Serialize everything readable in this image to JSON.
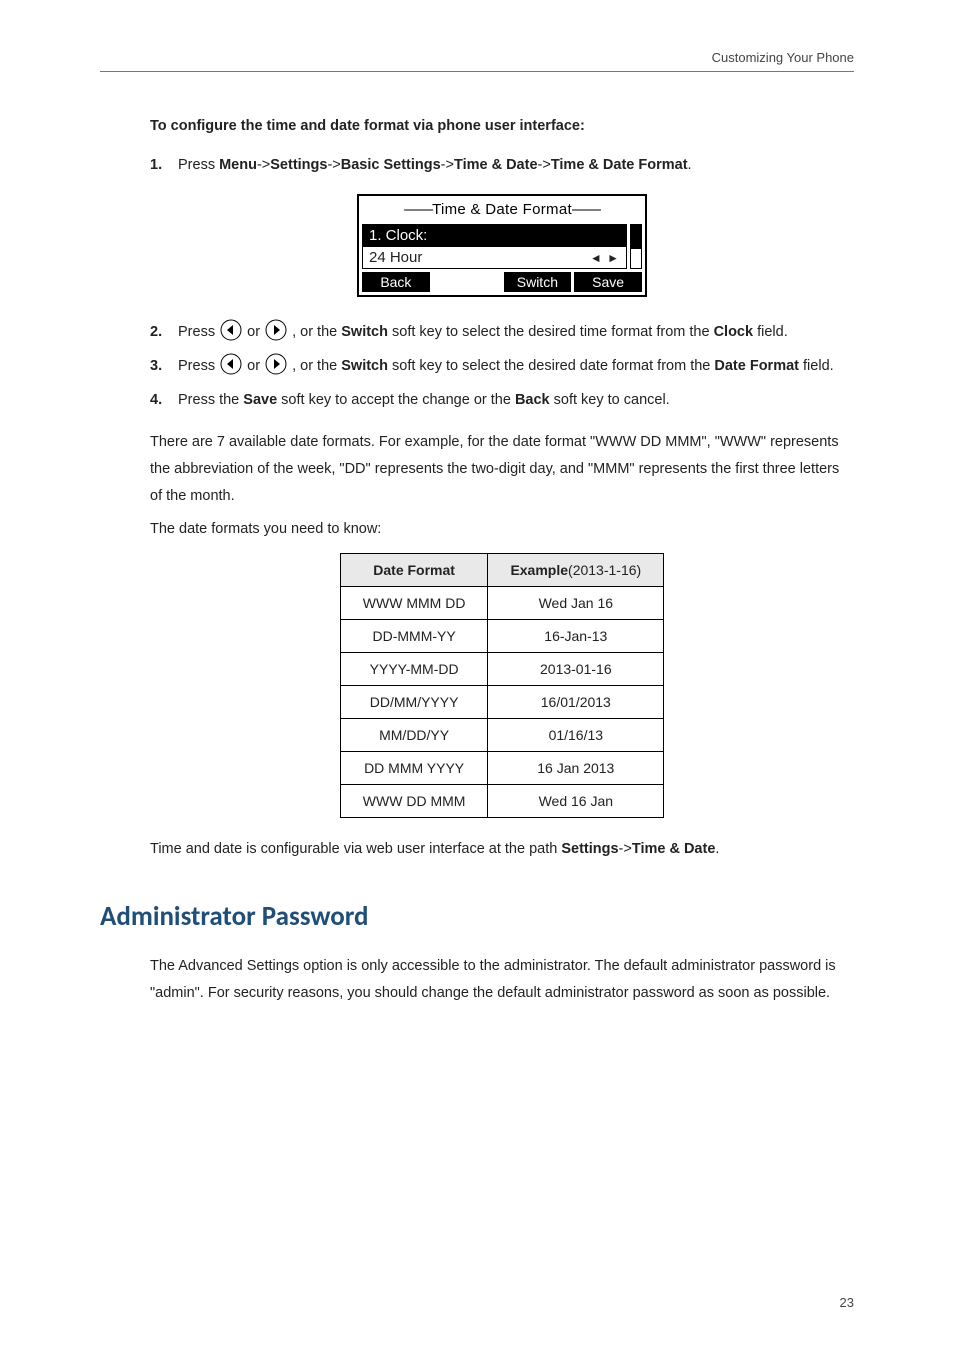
{
  "running_head": "Customizing Your Phone",
  "intro_heading": "To configure the time and date format via phone user interface:",
  "steps": {
    "s1_prefix": "Press ",
    "s1_menu": "Menu",
    "s1_settings": "Settings",
    "s1_basic": "Basic Settings",
    "s1_time_date": "Time & Date",
    "s1_format": "Time & Date Format",
    "s1_sep": "->",
    "s1_suffix": ".",
    "s2_prefix": "Press ",
    "s2_mid": " or ",
    "s2_after_keys": " , or the ",
    "switch": "Switch",
    "s2_tail_a": " soft key to select the desired time format from the ",
    "clock": "Clock",
    "s2_tail_b": " field.",
    "s3_tail_a": " soft key to select the desired date format from the ",
    "dateformat": "Date Format",
    "s4_prefix": "Press the ",
    "save": "Save",
    "s4_mid": " soft key to accept the change or the ",
    "back": "Back",
    "s4_tail": " soft key to cancel."
  },
  "figure": {
    "title_pre": "——",
    "title": "Time & Date Format",
    "title_post": "——",
    "row_label": "1. Clock:",
    "row_value": "24 Hour",
    "arrows": "◄ ►",
    "sk1": "Back",
    "sk3": "Switch",
    "sk4": "Save"
  },
  "para1": "There are 7 available date formats. For example, for the date format \"WWW DD MMM\", \"WWW\" represents the abbreviation of the week, \"DD\" represents the two-digit day, and \"MMM\" represents the first three letters of the month.",
  "para2": "The date formats you need to know:",
  "table": {
    "head1": "Date Format",
    "head2_bold": "Example",
    "head2_rest": "(2013-1-16)",
    "rows": [
      {
        "fmt": "WWW MMM DD",
        "ex": "Wed Jan 16"
      },
      {
        "fmt": "DD-MMM-YY",
        "ex": "16-Jan-13"
      },
      {
        "fmt": "YYYY-MM-DD",
        "ex": "2013-01-16"
      },
      {
        "fmt": "DD/MM/YYYY",
        "ex": "16/01/2013"
      },
      {
        "fmt": "MM/DD/YY",
        "ex": "01/16/13"
      },
      {
        "fmt": "DD MMM YYYY",
        "ex": "16 Jan 2013"
      },
      {
        "fmt": "WWW DD MMM",
        "ex": "Wed 16 Jan"
      }
    ]
  },
  "post_table_pre": "Time and date is configurable via web user interface at the path ",
  "post_table_settings": "Settings",
  "post_table_sep": "->",
  "post_table_td": "Time & Date",
  "post_table_suffix": ".",
  "section_heading": "Administrator Password",
  "section_body": "The Advanced Settings option is only accessible to the administrator. The default administrator password is \"admin\". For security reasons, you should change the default administrator password as soon as possible.",
  "page_number": "23",
  "icons": {
    "left_arrow_alt": "left-arrow directional key",
    "right_arrow_alt": "right-arrow directional key"
  }
}
